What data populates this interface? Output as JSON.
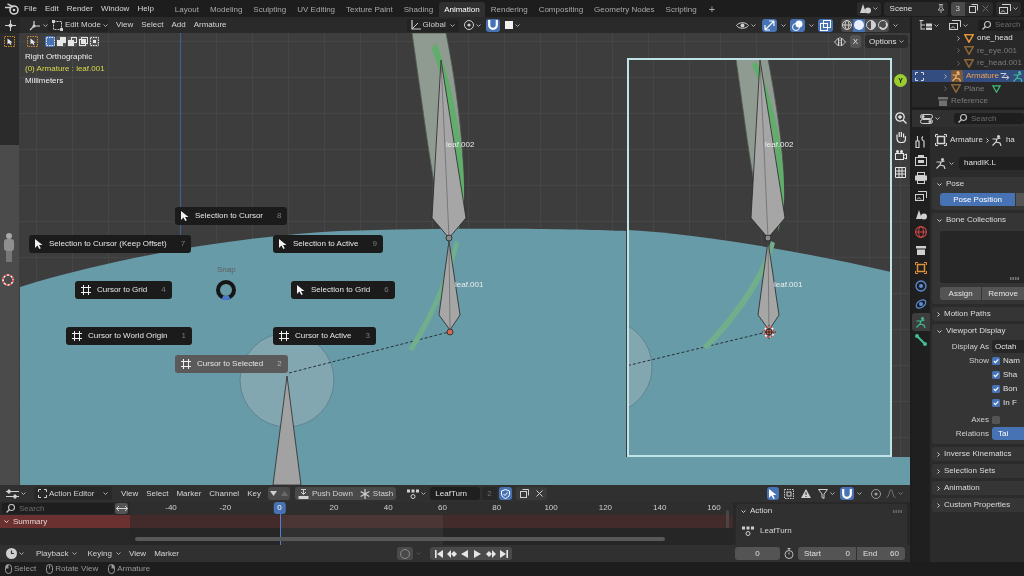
{
  "top_bar": {
    "menus": [
      "File",
      "Edit",
      "Render",
      "Window",
      "Help"
    ],
    "workspaces": [
      {
        "label": "Layout",
        "selected": false
      },
      {
        "label": "Modeling",
        "selected": false
      },
      {
        "label": "Sculpting",
        "selected": false
      },
      {
        "label": "UV Editing",
        "selected": false
      },
      {
        "label": "Texture Paint",
        "selected": false
      },
      {
        "label": "Shading",
        "selected": false
      },
      {
        "label": "Animation",
        "selected": true
      },
      {
        "label": "Rendering",
        "selected": false
      },
      {
        "label": "Compositing",
        "selected": false
      },
      {
        "label": "Geometry Nodes",
        "selected": false
      },
      {
        "label": "Scripting",
        "selected": false
      }
    ],
    "add_workspace": "+",
    "scene": "Scene",
    "scene_users": "3"
  },
  "viewport": {
    "header": {
      "mode": "Edit Mode",
      "menus": [
        "View",
        "Select",
        "Add",
        "Armature"
      ],
      "orientation": "Global",
      "snapping": {
        "on": true
      },
      "overlay_toggles": [
        {
          "kind": "gizmo",
          "on": true
        },
        {
          "kind": "overlays",
          "on": true
        },
        {
          "kind": "xray",
          "on": true
        }
      ],
      "shading_modes": [
        {
          "kind": "wireframe",
          "selected": false
        },
        {
          "kind": "solid",
          "selected": true
        },
        {
          "kind": "material",
          "selected": false
        },
        {
          "kind": "rendered",
          "selected": false
        }
      ]
    },
    "tool_settings": {
      "select_modes": [
        {
          "kind": "set",
          "selected": true
        },
        {
          "kind": "extend",
          "selected": false
        },
        {
          "kind": "subtract",
          "selected": false
        },
        {
          "kind": "invert",
          "selected": false
        },
        {
          "kind": "intersect",
          "selected": false
        }
      ],
      "mirror": {
        "label": "X",
        "on": false
      },
      "options": "Options"
    },
    "info": [
      {
        "kind": "view",
        "text": "Right Orthographic"
      },
      {
        "kind": "active",
        "text": "(0) Armature : leaf.001"
      },
      {
        "kind": "units",
        "text": "Millimeters"
      }
    ],
    "bone_labels": [
      "leaf.002",
      "leaf.001"
    ],
    "camera_view": {
      "bone_labels": [
        "leaf.002",
        "leaf.001"
      ]
    },
    "axis_gizmo": "Y",
    "pie_menu": {
      "title": "Snap",
      "items": [
        {
          "label": "Selection to Cursor",
          "shortcut": "8",
          "kind": "selection",
          "selected": false
        },
        {
          "label": "Selection to Cursor (Keep Offset)",
          "shortcut": "7",
          "kind": "selection",
          "selected": false
        },
        {
          "label": "Selection to Active",
          "shortcut": "9",
          "kind": "selection",
          "selected": false
        },
        {
          "label": "Cursor to Grid",
          "shortcut": "4",
          "kind": "cursor",
          "selected": false
        },
        {
          "label": "Selection to Grid",
          "shortcut": "6",
          "kind": "selection",
          "selected": false
        },
        {
          "label": "Cursor to World Origin",
          "shortcut": "1",
          "kind": "cursor",
          "selected": false
        },
        {
          "label": "Cursor to Active",
          "shortcut": "3",
          "kind": "cursor",
          "selected": false
        },
        {
          "label": "Cursor to Selected",
          "shortcut": "2",
          "kind": "cursor",
          "selected": true
        }
      ]
    }
  },
  "outliner": {
    "search": {
      "placeholder": "Search"
    },
    "items": [
      {
        "children": [
          {
            "children": [
              {
                "name": "one_head",
                "kind": "mesh",
                "expanded": false,
                "hidden": false,
                "selected": false,
                "inline_data": false
              },
              {
                "name": "re_eye.001",
                "kind": "mesh",
                "expanded": false,
                "hidden": true,
                "selected": false,
                "inline_data": false
              },
              {
                "name": "re_head.001",
                "kind": "mesh",
                "expanded": false,
                "hidden": true,
                "selected": false,
                "inline_data": false
              }
            ]
          },
          {
            "name": "Armature",
            "kind": "armature",
            "expanded": false,
            "hidden": false,
            "selected": true,
            "inline_data": true
          },
          {
            "name": "Plane",
            "kind": "mesh",
            "expanded": false,
            "hidden": true,
            "selected": false,
            "inline_data": true
          }
        ]
      },
      {
        "name": "Reference",
        "kind": "collection",
        "hidden": true,
        "selected": false
      }
    ]
  },
  "properties": {
    "search": {
      "placeholder": "Search"
    },
    "tabs": [
      {
        "kind": "tool",
        "selected": false
      },
      {
        "kind": "render",
        "selected": false
      },
      {
        "kind": "output",
        "selected": false
      },
      {
        "kind": "view_layer",
        "selected": false
      },
      {
        "kind": "scene",
        "selected": false
      },
      {
        "kind": "world",
        "selected": false
      },
      {
        "kind": "collection",
        "selected": false
      },
      {
        "kind": "object",
        "selected": false
      },
      {
        "kind": "physics",
        "selected": false
      },
      {
        "kind": "constraints",
        "selected": false
      },
      {
        "kind": "armature",
        "selected": true
      },
      {
        "kind": "bone",
        "selected": false
      }
    ],
    "breadcrumb": [
      "Armature",
      "ha"
    ],
    "bone_name": "handIK.L",
    "panels": [
      {
        "kind": "pose",
        "title": "Pose",
        "expanded": true,
        "options": [
          {
            "label": "Pose Position",
            "selected": true
          },
          {
            "selected": false
          }
        ]
      },
      {
        "kind": "collections",
        "title": "Bone Collections",
        "expanded": true,
        "buttons": [
          "Assign",
          "Remove"
        ]
      },
      {
        "title": "Motion Paths",
        "expanded": false
      },
      {
        "kind": "display",
        "title": "Viewport Display",
        "expanded": true,
        "display_as": {
          "label": "Display As",
          "value": "Octah"
        },
        "show": {
          "label": "Show",
          "options": [
            {
              "label": "Nam",
              "checked": true
            },
            {
              "label": "Sha",
              "checked": true
            },
            {
              "label": "Bon",
              "checked": true
            },
            {
              "label": "In F",
              "checked": true
            }
          ]
        },
        "axes": {
          "label": "Axes",
          "checked": false
        },
        "relations": {
          "label": "Relations",
          "value": "Tai",
          "selected": true
        }
      },
      {
        "title": "Inverse Kinematics",
        "expanded": false
      },
      {
        "title": "Selection Sets",
        "expanded": false
      },
      {
        "title": "Animation",
        "expanded": false
      },
      {
        "title": "Custom Properties",
        "expanded": false
      }
    ]
  },
  "action_editor": {
    "mode": "Action Editor",
    "menus": [
      "View",
      "Select",
      "Marker",
      "Channel",
      "Key"
    ],
    "push_down": "Push Down",
    "stash": "Stash",
    "action": {
      "name": "LeafTurn",
      "users": "2",
      "fake_user": true
    },
    "filters": [
      {
        "kind": "only_selected",
        "on": true
      },
      {
        "kind": "show_hidden",
        "on": false
      },
      {
        "kind": "only_errors",
        "on": false
      }
    ],
    "snapping": {
      "on": true
    },
    "search": {
      "placeholder": "Search"
    },
    "ruler": [
      {
        "label": "-40",
        "current": false
      },
      {
        "label": "-20",
        "current": false
      },
      {
        "label": "0",
        "current": true
      },
      {
        "label": "20",
        "current": false
      },
      {
        "label": "40",
        "current": false
      },
      {
        "label": "60",
        "current": false
      },
      {
        "label": "80",
        "current": false
      },
      {
        "label": "100",
        "current": false
      },
      {
        "label": "120",
        "current": false
      },
      {
        "label": "140",
        "current": false
      },
      {
        "label": "160",
        "current": false
      }
    ],
    "channels": [
      {
        "name": "Summary",
        "expanded": true
      }
    ],
    "sidebar": {
      "title": "Action",
      "expanded": true,
      "action_name": "LeafTurn"
    }
  },
  "timeline": {
    "dropdowns": [
      "Playback",
      "Keying"
    ],
    "menus": [
      "View",
      "Marker"
    ],
    "current_frame": "0",
    "start": {
      "label": "Start",
      "value": "0"
    },
    "end": {
      "label": "End",
      "value": "60"
    }
  },
  "status_bar": [
    {
      "kind": "left",
      "label": "Select"
    },
    {
      "kind": "middle",
      "label": "Rotate View"
    },
    {
      "kind": "right",
      "label": "Armature"
    }
  ]
}
